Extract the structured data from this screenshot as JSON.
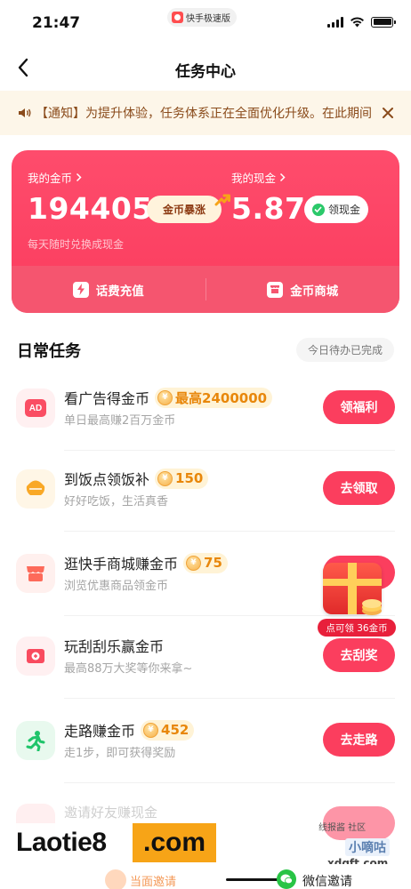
{
  "status_bar": {
    "time": "21:47",
    "app_badge": "快手极速版"
  },
  "nav": {
    "title": "任务中心"
  },
  "notice": {
    "text": "【通知】为提升体验，任务体系正在全面优化升级。在此期间"
  },
  "coin_card": {
    "coins_label": "我的金币",
    "coins_value": "194405",
    "surge_label": "金币暴涨",
    "cash_label": "我的现金",
    "cash_value": "5.87",
    "claim_cash_label": "领现金",
    "subtitle": "每天随时兑换成现金",
    "recharge_label": "话费充值",
    "mall_label": "金币商城"
  },
  "daily": {
    "title": "日常任务",
    "pending_label": "今日待办已完成"
  },
  "tasks": [
    {
      "icon": "ad-icon",
      "title": "看广告得金币",
      "badge": "最高2400000",
      "desc": "单日最高赚2百万金币",
      "button": "领福利"
    },
    {
      "icon": "meal-icon",
      "title": "到饭点领饭补",
      "badge": "150",
      "desc": "好好吃饭，生活真香",
      "button": "去领取"
    },
    {
      "icon": "store-icon",
      "title": "逛快手商城赚金币",
      "badge": "75",
      "desc": "浏览优惠商品领金币",
      "button": ""
    },
    {
      "icon": "scratch-icon",
      "title": "玩刮刮乐赢金币",
      "badge": "",
      "desc": "最高88万大奖等你来拿~",
      "button": "去刮奖"
    },
    {
      "icon": "walk-icon",
      "title": "走路赚金币",
      "badge": "452",
      "desc": "走1步，即可获得奖励",
      "button": "去走路"
    }
  ],
  "floating_gift": {
    "label": "点可领 36金币"
  },
  "partial": {
    "invite_title": "邀请好友赚现金",
    "share_left": "当面邀请",
    "wechat_invite": "微信邀请"
  },
  "watermarks": {
    "left_text": "Laotie8",
    "left_suffix": ".com",
    "right_top": "线报酱 社区",
    "right_mid": "小嘀咕",
    "right_bottom": "xdgft.com"
  },
  "colors": {
    "brand_red": "#fb3e5e",
    "coin_gold": "#e8870b",
    "notice_bg": "#fdf6e9"
  }
}
